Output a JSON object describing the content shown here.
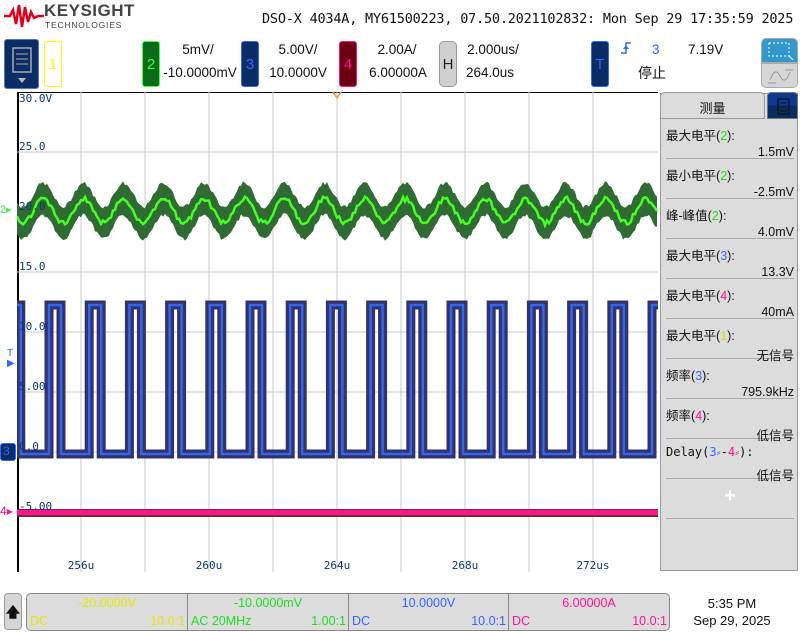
{
  "header": {
    "brand": "KEYSIGHT",
    "brand_sub": "TECHNOLOGIES",
    "title": "DSO-X 4034A, MY61500223, 07.50.2021102832: Mon Sep 29 17:35:59 2025"
  },
  "toolbar": {
    "ch1": {
      "label": "1",
      "color": "#ffff00"
    },
    "ch2": {
      "label": "2",
      "scale": "5mV/",
      "offset": "-10.0000mV",
      "color": "#22dd22"
    },
    "ch3": {
      "label": "3",
      "scale": "5.00V/",
      "offset": "10.0000V",
      "color": "#3366ff"
    },
    "ch4": {
      "label": "4",
      "scale": "2.00A/",
      "offset": "6.00000A",
      "color": "#ff1493"
    },
    "horizontal": {
      "label": "H",
      "scale": "2.000us/",
      "delay": "264.0us"
    },
    "trigger": {
      "label": "T",
      "slope_icon": "rising-edge-icon",
      "source": "3",
      "level": "7.19V",
      "status": "停止"
    }
  },
  "plot": {
    "y_labels": [
      "30.0V",
      "25.0",
      "20.0",
      "15.0",
      "10.0",
      "5.00",
      "0.0",
      "-5.00"
    ],
    "x_labels": [
      "256u",
      "260u",
      "264u",
      "268u",
      "272us"
    ],
    "ch2_marker": "2",
    "ch3_marker": "3",
    "ch4_marker": "4",
    "trigger_marker": "T"
  },
  "measurements": {
    "tab": "测量",
    "items": [
      {
        "name": "最大电平",
        "ch": "2",
        "ch_color": "#22dd22",
        "value": "1.5mV"
      },
      {
        "name": "最小电平",
        "ch": "2",
        "ch_color": "#22dd22",
        "value": "-2.5mV"
      },
      {
        "name": "峰-峰值",
        "ch": "2",
        "ch_color": "#22dd22",
        "value": "4.0mV"
      },
      {
        "name": "最大电平",
        "ch": "3",
        "ch_color": "#3366ff",
        "value": "13.3V"
      },
      {
        "name": "最大电平",
        "ch": "4",
        "ch_color": "#ff1493",
        "value": "40mA"
      },
      {
        "name": "最大电平",
        "ch": "1",
        "ch_color": "#dddd00",
        "value": "无信号"
      },
      {
        "name": "频率",
        "ch": "3",
        "ch_color": "#3366ff",
        "value": "795.9kHz"
      },
      {
        "name": "频率",
        "ch": "4",
        "ch_color": "#ff1493",
        "value": "低信号"
      }
    ],
    "delay": {
      "name": "Delay",
      "a": "3",
      "b": "4",
      "value": "低信号"
    },
    "add": "+"
  },
  "bottom": {
    "channels": [
      {
        "offset": "-20.0000V",
        "coupling": "DC",
        "probe": "10.0:1",
        "color": "#e6e600"
      },
      {
        "offset": "-10.0000mV",
        "coupling": "AC 20MHz",
        "probe": "1.00:1",
        "color": "#22dd22"
      },
      {
        "offset": "10.0000V",
        "coupling": "DC",
        "probe": "10.0:1",
        "color": "#3366ff"
      },
      {
        "offset": "6.00000A",
        "coupling": "DC",
        "probe": "10.0:1",
        "color": "#ff1493"
      }
    ],
    "time": "5:35 PM",
    "date": "Sep 29, 2025"
  }
}
